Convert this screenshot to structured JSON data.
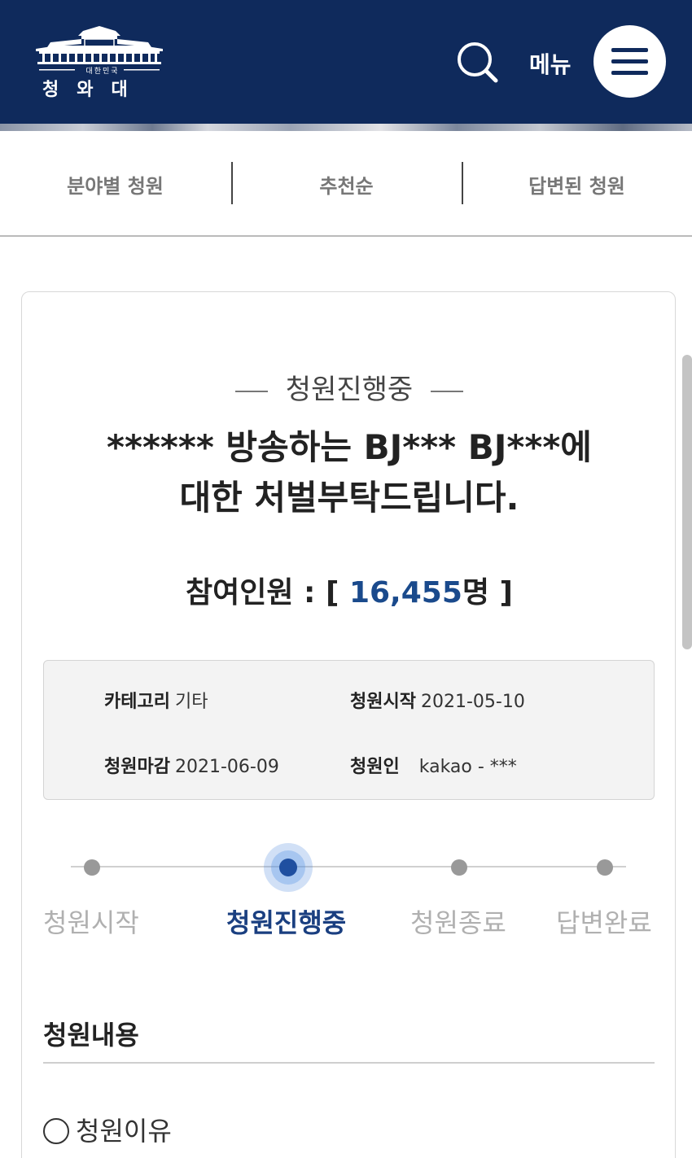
{
  "header": {
    "logo_small_text": "대한민국",
    "logo_text": "청와대",
    "menu_label": "메뉴"
  },
  "tabs": [
    {
      "label": "분야별 청원"
    },
    {
      "label": "추천순"
    },
    {
      "label": "답변된 청원"
    }
  ],
  "petition": {
    "status": "청원진행중",
    "title_line1": "****** 방송하는 BJ*** BJ***에",
    "title_line2": "대한 처벌부탁드립니다.",
    "participants_label": "참여인원 : [ ",
    "participants_count": "16,455",
    "participants_unit": "명 ]",
    "info": {
      "category_label": "카테고리",
      "category_value": "기타",
      "start_label": "청원시작",
      "start_value": "2021-05-10",
      "end_label": "청원마감",
      "end_value": "2021-06-09",
      "petitioner_label": "청원인",
      "petitioner_value": "kakao - ***"
    },
    "steps": [
      {
        "label": "청원시작"
      },
      {
        "label": "청원진행중"
      },
      {
        "label": "청원종료"
      },
      {
        "label": "답변완료"
      }
    ],
    "current_step": 2,
    "section_title": "청원내용",
    "reason_label": "청원이유"
  },
  "colors": {
    "header_bg": "#0f2a5c",
    "accent": "#1a4a8c",
    "active_step": "#1f4fa0"
  }
}
